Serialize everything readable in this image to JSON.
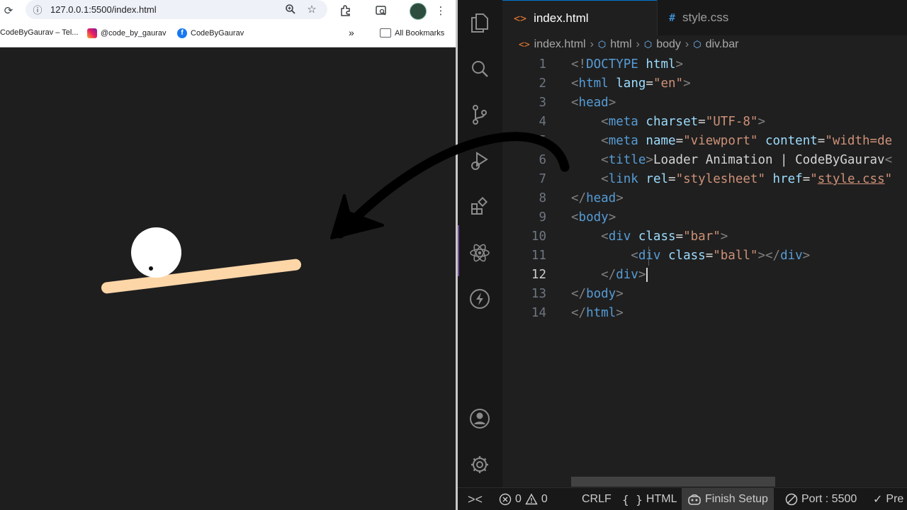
{
  "browser": {
    "url": "127.0.0.1:5500/index.html",
    "bookmarks": [
      {
        "label": "CodeByGaurav – Tel..."
      },
      {
        "label": "@code_by_gaurav"
      },
      {
        "label": "CodeByGaurav"
      }
    ],
    "all_bookmarks": "All Bookmarks",
    "more_glyph": "»"
  },
  "editor": {
    "tabs": [
      {
        "label": "index.html",
        "icon": "<>"
      },
      {
        "label": "style.css",
        "icon": "#"
      }
    ],
    "breadcrumb": [
      "index.html",
      "html",
      "body",
      "div.bar"
    ],
    "line_numbers": [
      "1",
      "2",
      "3",
      "4",
      "5",
      "6",
      "7",
      "8",
      "9",
      "10",
      "11",
      "12",
      "13",
      "14"
    ],
    "current_line": "12"
  },
  "status_bar": {
    "errors": "0",
    "warnings": "0",
    "eol": "CRLF",
    "language": "HTML",
    "finish_setup": "Finish Setup",
    "port": "Port : 5500",
    "prettier": "Pre"
  },
  "colors": {
    "bar": "#fdd6a8",
    "ball": "#ffffff",
    "stage_bg": "#1e1e1e",
    "editor_bg": "#1f1f1f",
    "accent": "#0078d4"
  }
}
